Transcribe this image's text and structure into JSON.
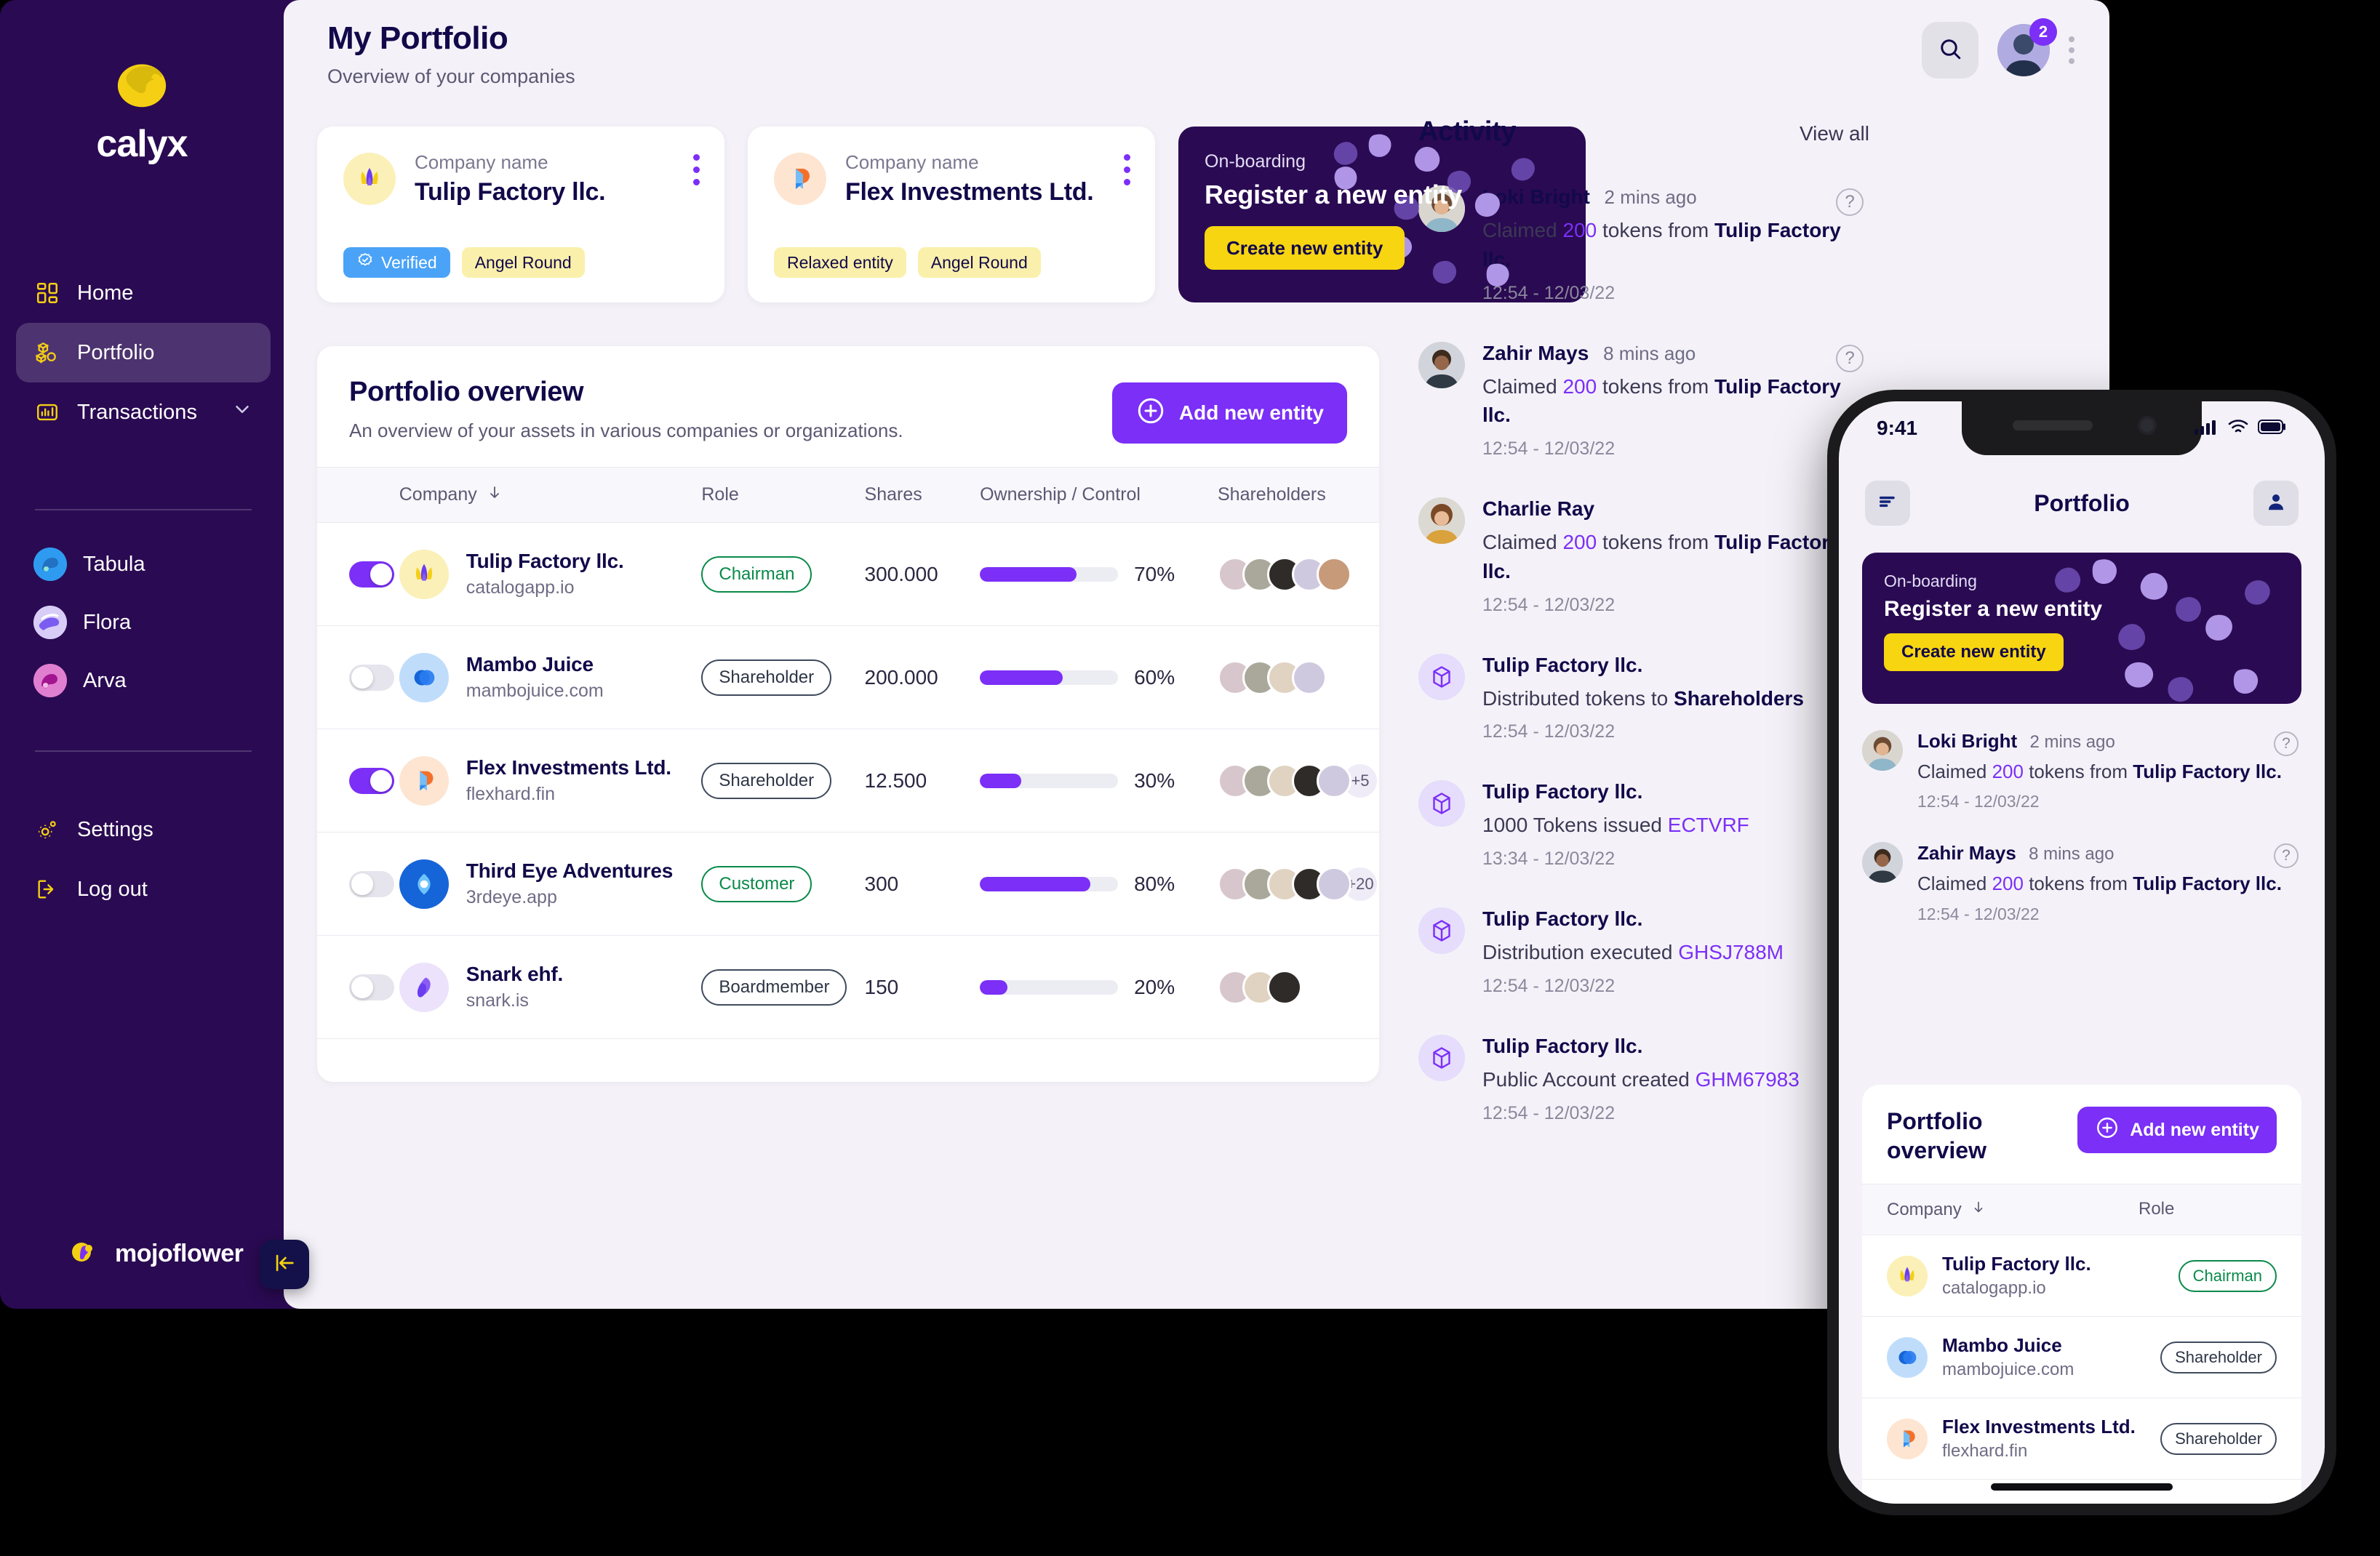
{
  "brand": {
    "name": "calyx",
    "footer_name": "mojoflower"
  },
  "sidebar": {
    "nav": [
      {
        "label": "Home",
        "icon": "grid-icon",
        "active": false
      },
      {
        "label": "Portfolio",
        "icon": "boxes-icon",
        "active": true
      },
      {
        "label": "Transactions",
        "icon": "chart-bars-icon",
        "active": false,
        "chevron": "chevron-down-icon"
      }
    ],
    "orgs": [
      {
        "label": "Tabula",
        "color": "#2f9bf0"
      },
      {
        "label": "Flora",
        "color": "#7b5cf0"
      },
      {
        "label": "Arva",
        "color": "#c43ab0"
      }
    ],
    "bottom": [
      {
        "label": "Settings",
        "icon": "gear-icon"
      },
      {
        "label": "Log out",
        "icon": "logout-icon"
      }
    ],
    "collapse": "collapse-sidebar-icon"
  },
  "header": {
    "title": "My Portfolio",
    "subtitle": "Overview of your companies",
    "search_icon": "search-icon",
    "avatar_badge": "2",
    "kebab_icon": "kebab-menu-icon"
  },
  "company_cards": [
    {
      "label": "Company name",
      "name": "Tulip Factory llc.",
      "logo": "tulip-logo",
      "logo_bg": "#fbf0b7",
      "chips": [
        {
          "text": "Verified",
          "style": "blue",
          "icon": "verified-badge-icon"
        },
        {
          "text": "Angel Round",
          "style": "yellow"
        }
      ]
    },
    {
      "label": "Company name",
      "name": "Flex Investments Ltd.",
      "logo": "flex-logo",
      "logo_bg": "#fde5d2",
      "chips": [
        {
          "text": "Relaxed entity",
          "style": "yellow"
        },
        {
          "text": "Angel Round",
          "style": "yellow"
        }
      ]
    }
  ],
  "onboarding": {
    "kicker": "On-boarding",
    "title": "Register a new entity",
    "button": "Create new entity"
  },
  "portfolio": {
    "title": "Portfolio overview",
    "subtitle": "An overview of your assets in various companies or organizations.",
    "add_button": "Add new entity",
    "add_icon": "plus-circle-icon",
    "columns": [
      "Company",
      "Role",
      "Shares",
      "Ownership / Control",
      "Shareholders"
    ],
    "sort_icon": "arrow-down-icon",
    "rows": [
      {
        "toggle": true,
        "name": "Tulip Factory llc.",
        "domain": "catalogapp.io",
        "logo": "tulip-logo",
        "logo_bg": "#fbf0b7",
        "role": "Chairman",
        "role_style": "green",
        "shares": "300.000",
        "pct": 70,
        "pct_label": "70%",
        "avatars": 5,
        "more": ""
      },
      {
        "toggle": false,
        "name": "Mambo Juice",
        "domain": "mambojuice.com",
        "logo": "mambo-logo",
        "logo_bg": "#bfddfb",
        "role": "Shareholder",
        "role_style": "dark",
        "shares": "200.000",
        "pct": 60,
        "pct_label": "60%",
        "avatars": 4,
        "more": ""
      },
      {
        "toggle": true,
        "name": "Flex Investments Ltd.",
        "domain": "flexhard.fin",
        "logo": "flex-logo",
        "logo_bg": "#fde5d2",
        "role": "Shareholder",
        "role_style": "dark",
        "shares": "12.500",
        "pct": 30,
        "pct_label": "30%",
        "avatars": 5,
        "more": "+5"
      },
      {
        "toggle": false,
        "name": "Third Eye Adventures",
        "domain": "3rdeye.app",
        "logo": "eye-logo",
        "logo_bg": "#1565d8",
        "role": "Customer",
        "role_style": "green",
        "shares": "300",
        "pct": 80,
        "pct_label": "80%",
        "avatars": 5,
        "more": "+20"
      },
      {
        "toggle": false,
        "name": "Snark ehf.",
        "domain": "snark.is",
        "logo": "snark-logo",
        "logo_bg": "#ece2fb",
        "role": "Boardmember",
        "role_style": "dark",
        "shares": "150",
        "pct": 20,
        "pct_label": "20%",
        "avatars": 3,
        "more": ""
      }
    ]
  },
  "activity": {
    "title": "Activity",
    "view_all": "View all",
    "help_icon": "question-circle-icon",
    "items": [
      {
        "type": "user",
        "who": "Loki Bright",
        "when": "2 mins ago",
        "text_pre": "Claimed ",
        "amount": "200",
        "text_mid": " tokens from ",
        "entity": "Tulip Factory llc.",
        "time": "12:54 - 12/03/22"
      },
      {
        "type": "user",
        "who": "Zahir Mays",
        "when": "8 mins ago",
        "text_pre": "Claimed ",
        "amount": "200",
        "text_mid": " tokens from ",
        "entity": "Tulip Factory llc.",
        "time": "12:54 - 12/03/22"
      },
      {
        "type": "user",
        "who": "Charlie Ray",
        "when": "",
        "text_pre": "Claimed ",
        "amount": "200",
        "text_mid": " tokens from ",
        "entity": "Tulip Factory llc.",
        "time": "12:54 - 12/03/22"
      },
      {
        "type": "token",
        "who": "Tulip Factory llc.",
        "when": "",
        "text_pre": "Distributed tokens to ",
        "amount": "",
        "text_mid": "",
        "entity": "Shareholders",
        "code": "",
        "time": "12:54 - 12/03/22"
      },
      {
        "type": "token",
        "who": "Tulip Factory llc.",
        "when": "",
        "text_pre": "1000 Tokens issued ",
        "amount": "",
        "text_mid": "",
        "entity": "",
        "code": "ECTVRF",
        "time": "13:34 - 12/03/22"
      },
      {
        "type": "token",
        "who": "Tulip Factory llc.",
        "when": "",
        "text_pre": "Distribution executed ",
        "amount": "",
        "text_mid": "",
        "entity": "",
        "code": "GHSJ788M",
        "time": "12:54 - 12/03/22"
      },
      {
        "type": "token",
        "who": "Tulip Factory llc.",
        "when": "",
        "text_pre": "Public Account created ",
        "amount": "",
        "text_mid": "",
        "entity": "",
        "code": "GHM67983",
        "time": "12:54 - 12/03/22"
      }
    ]
  },
  "phone": {
    "status": {
      "time": "9:41",
      "signal_icon": "cellular-signal-icon",
      "wifi_icon": "wifi-icon",
      "battery_icon": "battery-icon"
    },
    "header": {
      "menu_icon": "menu-icon",
      "title": "Portfolio",
      "profile_icon": "person-icon"
    },
    "onboarding": {
      "kicker": "On-boarding",
      "title": "Register a new entity",
      "button": "Create new entity"
    },
    "activity": [
      {
        "who": "Loki Bright",
        "when": "2 mins ago",
        "text_pre": "Claimed ",
        "amount": "200",
        "text_mid": " tokens from ",
        "entity": "Tulip Factory llc.",
        "time": "12:54 - 12/03/22"
      },
      {
        "who": "Zahir Mays",
        "when": "8 mins ago",
        "text_pre": "Claimed ",
        "amount": "200",
        "text_mid": " tokens from ",
        "entity": "Tulip Factory llc.",
        "time": "12:54 - 12/03/22"
      }
    ],
    "panel": {
      "title": "Portfolio overview",
      "add_button": "Add new entity",
      "add_icon": "plus-circle-icon",
      "columns": [
        "Company",
        "Role"
      ],
      "sort_icon": "arrow-down-icon",
      "rows": [
        {
          "name": "Tulip Factory llc.",
          "domain": "catalogapp.io",
          "logo": "tulip-logo",
          "logo_bg": "#fbf0b7",
          "role": "Chairman",
          "role_style": "green"
        },
        {
          "name": "Mambo Juice",
          "domain": "mambojuice.com",
          "logo": "mambo-logo",
          "logo_bg": "#bfddfb",
          "role": "Shareholder",
          "role_style": "dark"
        },
        {
          "name": "Flex Investments Ltd.",
          "domain": "flexhard.fin",
          "logo": "flex-logo",
          "logo_bg": "#fde5d2",
          "role": "Shareholder",
          "role_style": "dark"
        }
      ]
    }
  },
  "colors": {
    "accent": "#7b2ff7",
    "brand_dark": "#2a0a52",
    "yellow": "#f7d511",
    "green": "#0a8a4a",
    "bg": "#f4f2f8"
  }
}
